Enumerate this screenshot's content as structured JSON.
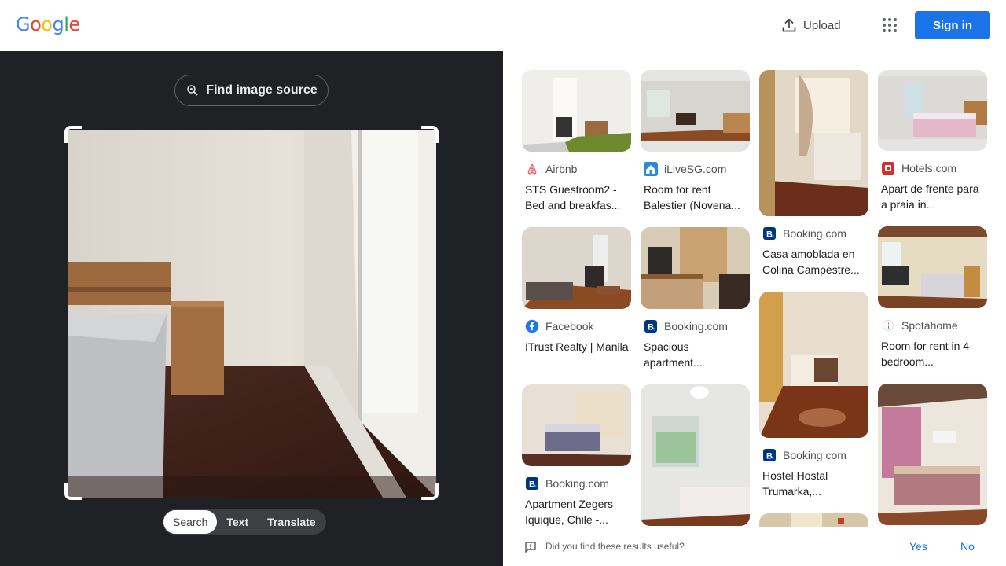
{
  "header": {
    "logo_letters": [
      "G",
      "o",
      "o",
      "g",
      "l",
      "e"
    ],
    "upload_label": "Upload",
    "apps_icon": "apps-grid-icon",
    "signin_label": "Sign in"
  },
  "query": {
    "find_source_label": "Find image source",
    "modes": [
      "Search",
      "Text",
      "Translate"
    ],
    "active_mode": "Search"
  },
  "results": [
    {
      "source": "Airbnb",
      "title": "STS Guestroom2 - Bed and breakfas...",
      "icon": "airbnb-icon"
    },
    {
      "source": "iLiveSG.com",
      "title": "Room for rent Balestier (Novena...",
      "icon": "ilivesg-icon"
    },
    {
      "source": "Booking.com",
      "title": "Casa amoblada en Colina Campestre...",
      "icon": "booking-icon"
    },
    {
      "source": "Hotels.com",
      "title": "Apart de frente para a praia in...",
      "icon": "hotels-icon"
    },
    {
      "source": "Facebook",
      "title": "ITrust Realty | Manila",
      "icon": "facebook-icon"
    },
    {
      "source": "Booking.com",
      "title": "Spacious apartment...",
      "icon": "booking-icon"
    },
    {
      "source": "Booking.com",
      "title": "Hostel Hostal Trumarka,...",
      "icon": "booking-icon"
    },
    {
      "source": "Spotahome",
      "title": "Room for rent in 4-bedroom...",
      "icon": "spotahome-icon"
    },
    {
      "source": "Booking.com",
      "title": "Apartment Zegers Iquique, Chile -...",
      "icon": "booking-icon"
    }
  ],
  "feedback": {
    "question": "Did you find these results useful?",
    "yes_label": "Yes",
    "no_label": "No"
  },
  "colors": {
    "accent": "#1a73e8",
    "panel_dark": "#202124",
    "booking": "#003580",
    "facebook": "#1877f2",
    "airbnb": "#ff5a5f",
    "hotels": "#d32f2f"
  }
}
